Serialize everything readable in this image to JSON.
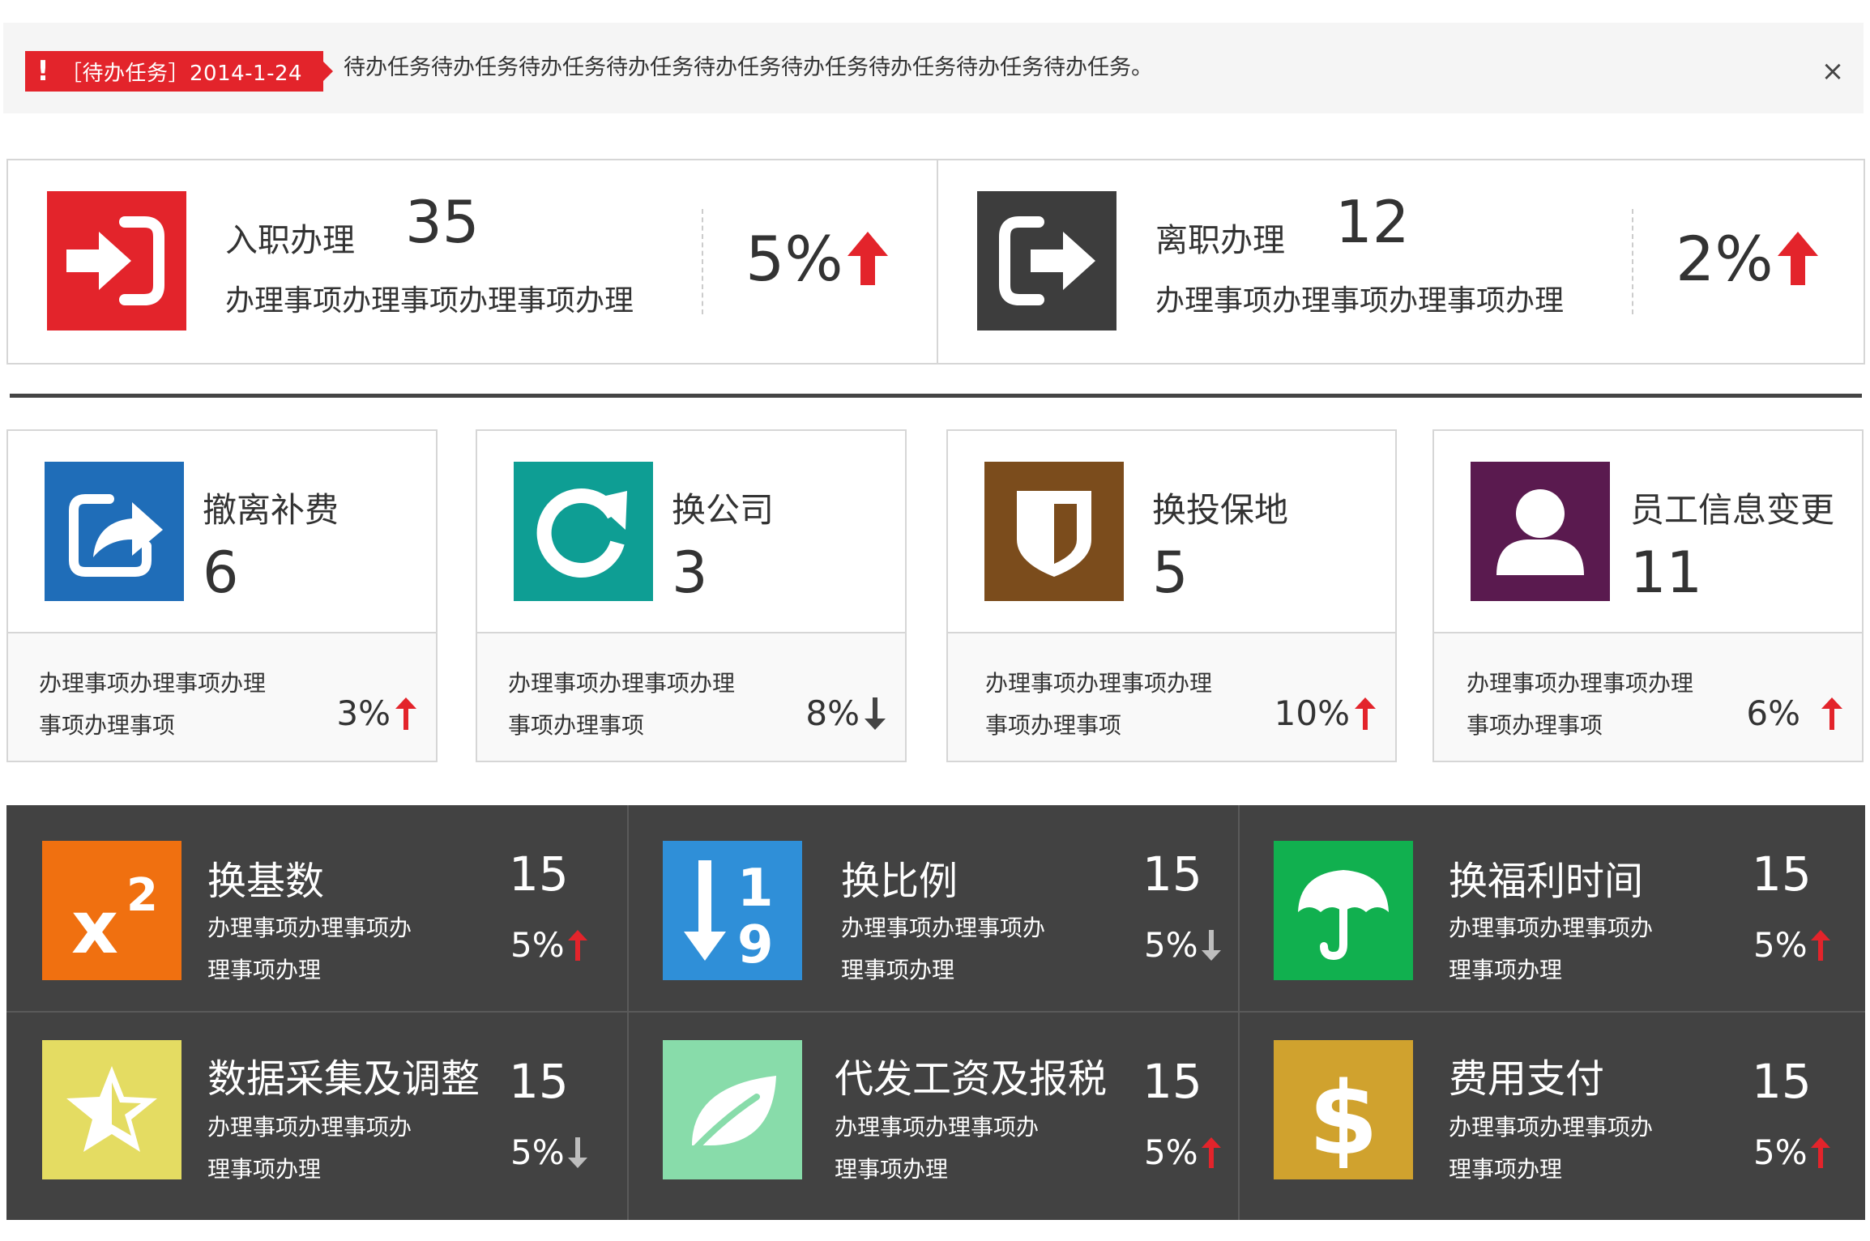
{
  "alert": {
    "tag": "［待办任务］2014-1-24",
    "message": "待办任务待办任务待办任务待办任务待办任务待办任务待办任务待办任务待办任务。",
    "close": "×"
  },
  "section1": [
    {
      "icon": "login-icon",
      "icon_color": "#e3242b",
      "title": "入职办理",
      "count": "35",
      "desc": "办理事项办理事项办理事项办理",
      "percent": "5%",
      "trend": "up"
    },
    {
      "icon": "logout-icon",
      "icon_color": "#3d3d3d",
      "title": "离职办理",
      "count": "12",
      "desc": "办理事项办理事项办理事项办理",
      "percent": "2%",
      "trend": "up"
    }
  ],
  "section2": [
    {
      "icon": "share-icon",
      "icon_color": "#1f6db8",
      "title": "撤离补费",
      "count": "6",
      "desc1": "办理事项办理事项办理",
      "desc2": "事项办理事项",
      "percent": "3%",
      "trend": "up"
    },
    {
      "icon": "refresh-icon",
      "icon_color": "#0e9e94",
      "title": "换公司",
      "count": "3",
      "desc1": "办理事项办理事项办理",
      "desc2": "事项办理事项",
      "percent": "8%",
      "trend": "down"
    },
    {
      "icon": "shield-icon",
      "icon_color": "#7b4c1c",
      "title": "换投保地",
      "count": "5",
      "desc1": "办理事项办理事项办理",
      "desc2": "事项办理事项",
      "percent": "10%",
      "trend": "up"
    },
    {
      "icon": "user-icon",
      "icon_color": "#5a1a4f",
      "title": "员工信息变更",
      "count": "11",
      "desc1": "办理事项办理事项办理",
      "desc2": "事项办理事项",
      "percent": "6%",
      "trend": "up"
    }
  ],
  "section3": [
    {
      "icon": "superscript-icon",
      "icon_color": "#f07010",
      "title": "换基数",
      "count": "15",
      "desc1": "办理事项办理事项办",
      "desc2": "理事项办理",
      "percent": "5%",
      "trend": "up"
    },
    {
      "icon": "sort-numeric-icon",
      "icon_color": "#2f8fd8",
      "title": "换比例",
      "count": "15",
      "desc1": "办理事项办理事项办",
      "desc2": "理事项办理",
      "percent": "5%",
      "trend": "down"
    },
    {
      "icon": "umbrella-icon",
      "icon_color": "#11b04f",
      "title": "换福利时间",
      "count": "15",
      "desc1": "办理事项办理事项办",
      "desc2": "理事项办理",
      "percent": "5%",
      "trend": "up"
    },
    {
      "icon": "star-half-icon",
      "icon_color": "#e4dc62",
      "title": "数据采集及调整",
      "count": "15",
      "desc1": "办理事项办理事项办",
      "desc2": "理事项办理",
      "percent": "5%",
      "trend": "down"
    },
    {
      "icon": "leaf-icon",
      "icon_color": "#88dcaa",
      "title": "代发工资及报税",
      "count": "15",
      "desc1": "办理事项办理事项办",
      "desc2": "理事项办理",
      "percent": "5%",
      "trend": "up"
    },
    {
      "icon": "dollar-icon",
      "icon_color": "#d0a22e",
      "title": "费用支付",
      "count": "15",
      "desc1": "办理事项办理事项办",
      "desc2": "理事项办理",
      "percent": "5%",
      "trend": "up"
    }
  ],
  "colors": {
    "up": "#e3242b",
    "down_light": "#444444",
    "down_dark": "#bdbdbd",
    "accent": "#e3242b"
  }
}
